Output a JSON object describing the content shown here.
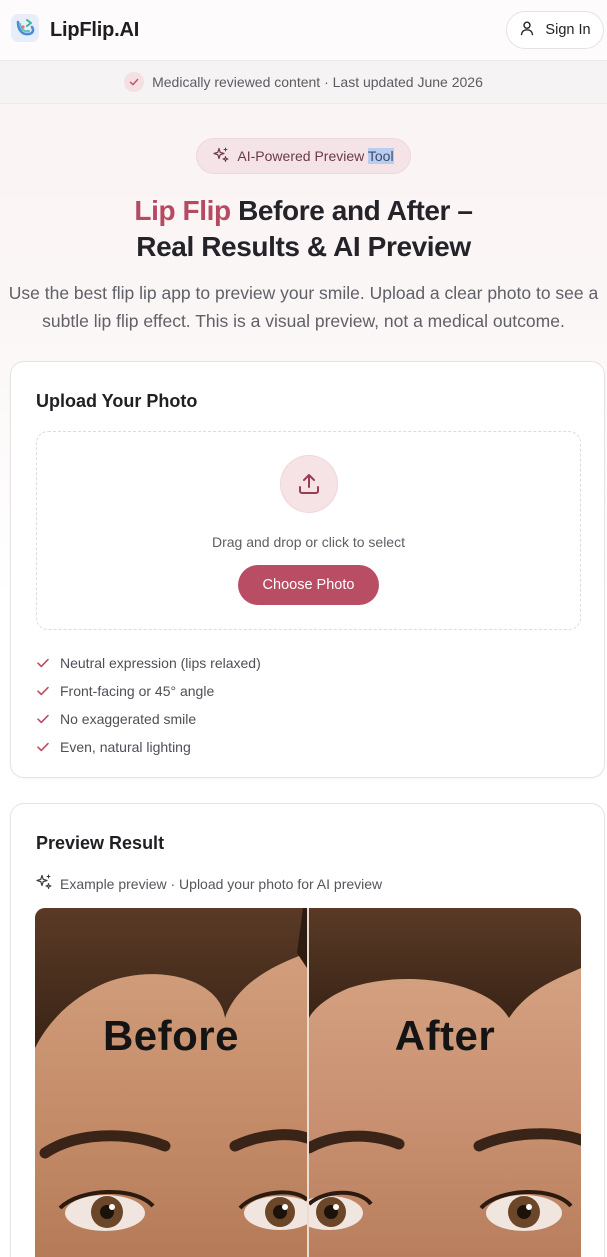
{
  "header": {
    "brand": "LipFlip.AI",
    "sign_in": "Sign In"
  },
  "notice": {
    "text": "Medically reviewed content · Last updated June 2026"
  },
  "hero": {
    "pill_prefix": "AI-Powered Preview ",
    "pill_selected": "Tool",
    "title_accent": "Lip Flip",
    "title_rest_line1": " Before and After –",
    "title_line2": "Real Results & AI Preview",
    "description": "Use the best flip lip app to preview your smile. Upload a clear photo to see a subtle lip flip effect. This is a visual preview, not a medical outcome."
  },
  "upload": {
    "title": "Upload Your Photo",
    "drop_text": "Drag and drop or click to select",
    "button": "Choose Photo",
    "tips": [
      "Neutral expression (lips relaxed)",
      "Front-facing or 45° angle",
      "No exaggerated smile",
      "Even, natural lighting"
    ]
  },
  "preview": {
    "title": "Preview Result",
    "subtitle": "Example preview · Upload your photo for AI preview",
    "before_label": "Before",
    "after_label": "After"
  },
  "colors": {
    "accent": "#b94d63",
    "accent_text": "#b64a62",
    "pill_bg": "#f5e4e7"
  }
}
